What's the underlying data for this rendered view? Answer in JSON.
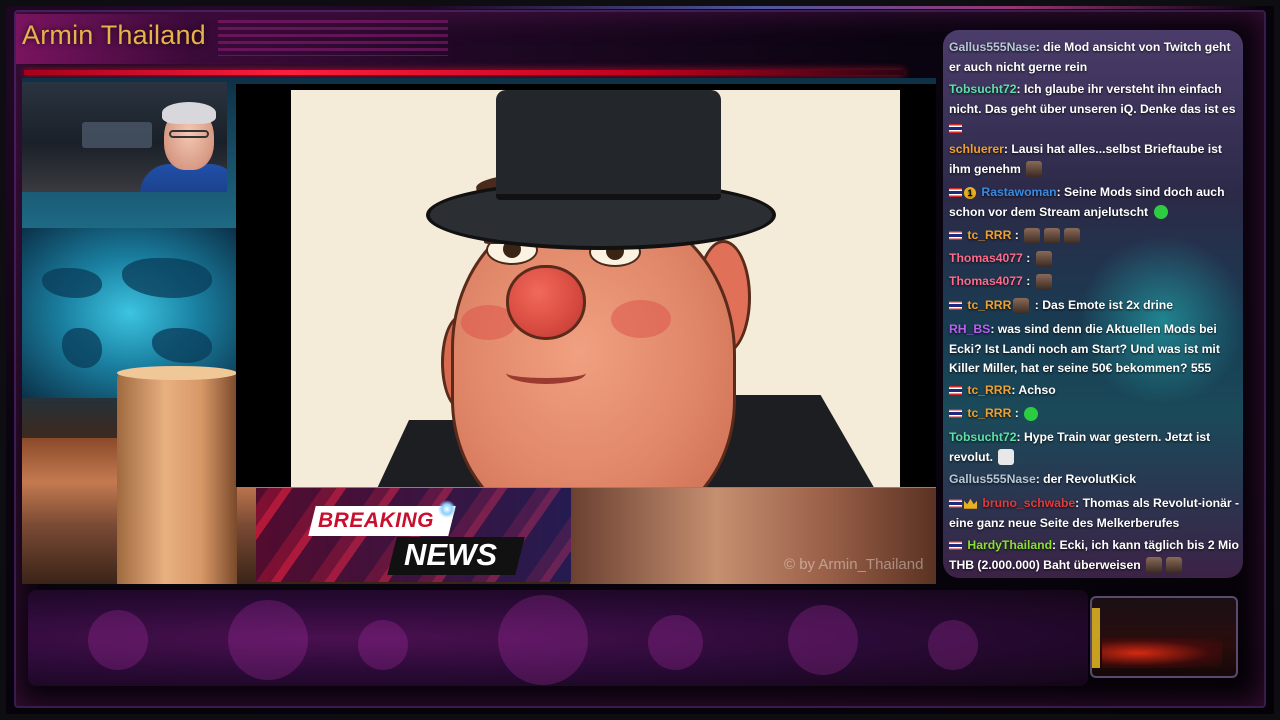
{
  "channel": {
    "title": "Armin Thailand"
  },
  "breaking": {
    "line1": "BREAKING",
    "line2": "NEWS"
  },
  "watermark": "© by Armin_Thailand",
  "chat": {
    "messages": [
      {
        "user": "Gallus555Nase",
        "user_color": "#b8c8d8",
        "text": ": die Mod ansicht von Twitch geht er auch nicht gerne rein"
      },
      {
        "user": "Tobsucht72",
        "user_color": "#5ce0a8",
        "text": ": Ich glaube ihr versteht ihn einfach nicht. Das geht über unseren iQ. Denke das ist es"
      },
      {
        "user": "schluerer",
        "user_color": "#f0a030",
        "text": ": Lausi hat alles...selbst Brieftaube ist ihm genehm"
      },
      {
        "user": "Rastawoman",
        "user_color": "#3a8ae0",
        "text": ": Seine Mods sind doch auch schon vor dem Stream anjelutscht"
      },
      {
        "user": "tc_RRR",
        "user_color": "#f0a030",
        "text": " :"
      },
      {
        "user": "Thomas4077",
        "user_color": "#ff6a8a",
        "text": " :"
      },
      {
        "user": "Thomas4077",
        "user_color": "#ff6a8a",
        "text": " :"
      },
      {
        "user": "tc_RRR",
        "user_color": "#f0a030",
        "text": " :  Das Emote ist 2x drine"
      },
      {
        "user": "RH_BS",
        "user_color": "#b860f0",
        "text": ": was sind denn die Aktuellen Mods bei Ecki? Ist Landi noch am Start? Und was ist mit Killer Miller, hat er seine 50€ bekommen? 555"
      },
      {
        "user": "tc_RRR",
        "user_color": "#f0a030",
        "text": ": Achso"
      },
      {
        "user": "tc_RRR",
        "user_color": "#f0a030",
        "text": " :"
      },
      {
        "user": "Tobsucht72",
        "user_color": "#5ce0a8",
        "text": ": Hype Train war gestern. Jetzt ist revolut."
      },
      {
        "user": "Gallus555Nase",
        "user_color": "#b8c8d8",
        "text": ": der RevolutKick"
      },
      {
        "user": "bruno_schwabe",
        "user_color": "#e03a3a",
        "text": ": Thomas als Revolut-ionär - eine ganz neue Seite des Melkerberufes"
      },
      {
        "user": "HardyThailand",
        "user_color": "#8ae030",
        "text": ": Ecki, ich kann täglich bis 2 Mio THB (2.000.000) Baht überweisen"
      }
    ]
  }
}
